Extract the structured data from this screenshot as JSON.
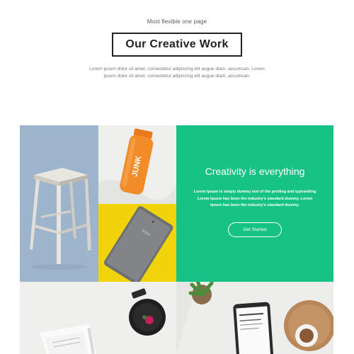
{
  "section": {
    "eyebrow": "Most flexible one page",
    "title": "Our Creative Work",
    "description_line1": "Lorem ipsum dolor sit amet, consectetur adipiscing elit augue diam, accumsan. Lorem",
    "description_line2": "ipsum dolor sit amet, consectetur adipiscing elit augue diam, accumsan."
  },
  "feature": {
    "heading": "Creativity is everything",
    "text_line1": "Lorem Ipsum is simply dummy text of the printing and typesetting",
    "text_line2": "Lorem Ipsum has been the industry's standard dummy. Lorem",
    "text_line3": "Ipsum has been the industry's standard dummy.",
    "button_label": "Get Started",
    "accent_color": "#17c286"
  },
  "bottle_label": "JUNK",
  "phone_label": "SONY",
  "icons": [
    "stool-photo",
    "juice-bottle-photo",
    "smartphone-photo",
    "desk-photo",
    "plant-phone-photo"
  ]
}
